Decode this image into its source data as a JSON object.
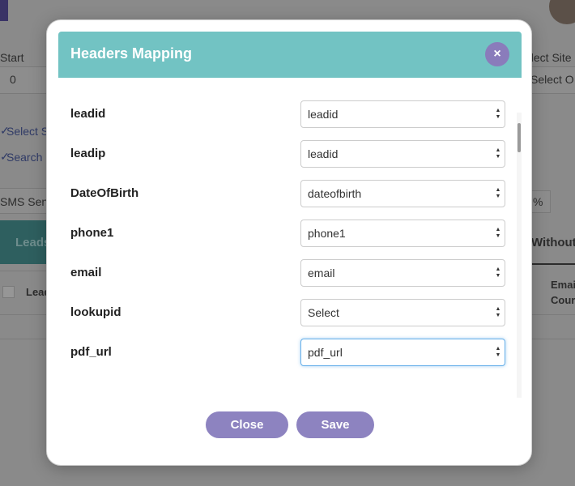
{
  "background": {
    "start_label": "Start",
    "start_value": "0",
    "select_site_label": "elect Site",
    "select_site_value": "Select O",
    "select_link": "Select S",
    "search_link": "Search l",
    "sms_sent": "SMS Sent",
    "percent": "%",
    "leads_tab": "Leads",
    "without_tab": "Without S",
    "col_lead": "Lead",
    "col_email_line1": "Emai",
    "col_email_line2": "Cour"
  },
  "modal": {
    "title": "Headers Mapping",
    "close_icon": "×",
    "rows": [
      {
        "label": "leadid",
        "value": "leadid"
      },
      {
        "label": "leadip",
        "value": "leadid"
      },
      {
        "label": "DateOfBirth",
        "value": "dateofbirth"
      },
      {
        "label": "phone1",
        "value": "phone1"
      },
      {
        "label": "email",
        "value": "email"
      },
      {
        "label": "lookupid",
        "value": "Select"
      },
      {
        "label": "pdf_url",
        "value": "pdf_url"
      }
    ],
    "close_button": "Close",
    "save_button": "Save"
  }
}
